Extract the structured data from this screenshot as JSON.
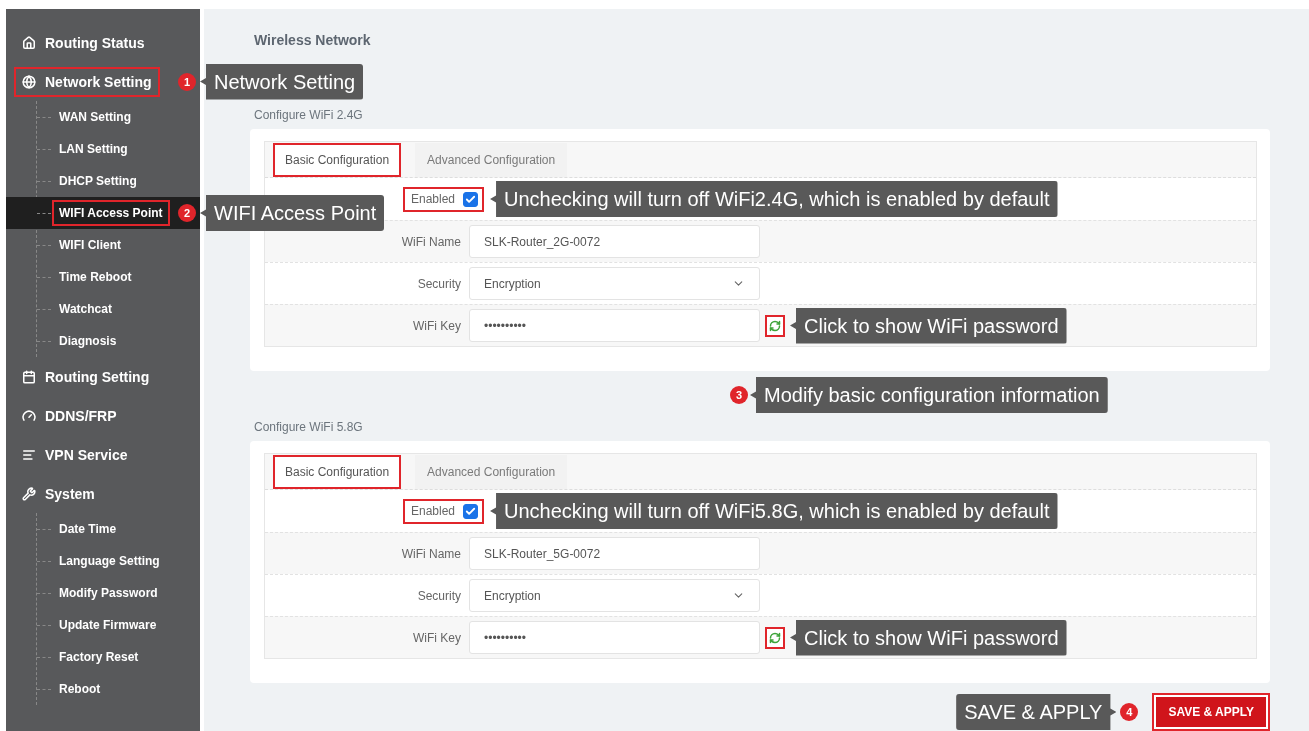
{
  "sidebar": {
    "items": [
      {
        "label": "Routing Status",
        "selected": false,
        "highlight": false
      },
      {
        "label": "Network Setting",
        "selected": false,
        "highlight": true,
        "annotation": {
          "badge": "1",
          "text": "Network Setting"
        },
        "children": [
          {
            "label": "WAN Setting",
            "selected": false,
            "highlight": false
          },
          {
            "label": "LAN Setting",
            "selected": false,
            "highlight": false
          },
          {
            "label": "DHCP Setting",
            "selected": false,
            "highlight": false
          },
          {
            "label": "WIFI Access Point",
            "selected": true,
            "highlight": true,
            "annotation": {
              "badge": "2",
              "text": "WIFI Access Point"
            }
          },
          {
            "label": "WIFI Client",
            "selected": false,
            "highlight": false
          },
          {
            "label": "Time Reboot",
            "selected": false,
            "highlight": false
          },
          {
            "label": "Watchcat",
            "selected": false,
            "highlight": false
          },
          {
            "label": "Diagnosis",
            "selected": false,
            "highlight": false
          }
        ]
      },
      {
        "label": "Routing Setting",
        "selected": false,
        "highlight": false
      },
      {
        "label": "DDNS/FRP",
        "selected": false,
        "highlight": false
      },
      {
        "label": "VPN Service",
        "selected": false,
        "highlight": false
      },
      {
        "label": "System",
        "selected": false,
        "highlight": false,
        "children": [
          {
            "label": "Date Time",
            "selected": false,
            "highlight": false
          },
          {
            "label": "Language Setting",
            "selected": false,
            "highlight": false
          },
          {
            "label": "Modify Password",
            "selected": false,
            "highlight": false
          },
          {
            "label": "Update Firmware",
            "selected": false,
            "highlight": false
          },
          {
            "label": "Factory Reset",
            "selected": false,
            "highlight": false
          },
          {
            "label": "Reboot",
            "selected": false,
            "highlight": false
          }
        ]
      }
    ]
  },
  "page_title": "Wireless Network",
  "sections": [
    {
      "heading": "Configure WiFi 2.4G",
      "tabs": [
        {
          "label": "Basic Configuration",
          "selected": true,
          "highlight": true
        },
        {
          "label": "Advanced Configuration",
          "selected": false,
          "highlight": false
        }
      ],
      "enabled": {
        "label": "Enabled",
        "checked": true,
        "highlight": true,
        "annotation": {
          "text": "Unchecking will turn off WiFi2.4G, which is enabled by default"
        }
      },
      "fields": [
        {
          "kind": "text",
          "label": "WiFi Name",
          "value": "SLK-Router_2G-0072"
        },
        {
          "kind": "select",
          "label": "Security",
          "value": "Encryption"
        },
        {
          "kind": "password",
          "label": "WiFi Key",
          "value": "••••••••••",
          "toggle_highlight": true,
          "annotation": {
            "text": "Click to show WiFi password"
          }
        }
      ],
      "annotation": {
        "badge": "3",
        "text": "Modify basic configuration information"
      }
    },
    {
      "heading": "Configure WiFi 5.8G",
      "tabs": [
        {
          "label": "Basic Configuration",
          "selected": true,
          "highlight": true
        },
        {
          "label": "Advanced Configuration",
          "selected": false,
          "highlight": false
        }
      ],
      "enabled": {
        "label": "Enabled",
        "checked": true,
        "highlight": true,
        "annotation": {
          "text": "Unchecking will turn off WiFi5.8G, which is enabled by default"
        }
      },
      "fields": [
        {
          "kind": "text",
          "label": "WiFi Name",
          "value": "SLK-Router_5G-0072"
        },
        {
          "kind": "select",
          "label": "Security",
          "value": "Encryption"
        },
        {
          "kind": "password",
          "label": "WiFi Key",
          "value": "••••••••••",
          "toggle_highlight": true,
          "annotation": {
            "text": "Click to show WiFi password"
          }
        }
      ]
    }
  ],
  "save_button": {
    "label": "SAVE & APPLY",
    "highlight": true,
    "annotation": {
      "badge": "4",
      "text": "SAVE & APPLY"
    }
  }
}
